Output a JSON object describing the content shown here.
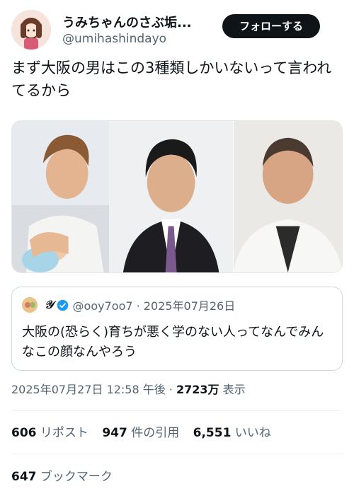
{
  "author": {
    "name": "うみちゃんのさぶ垢...",
    "handle": "@umihashindayo",
    "follow_label": "フォローする"
  },
  "tweet": {
    "text": "まず大阪の男はこの3種類しかいないって言われてるから"
  },
  "photos": [
    {
      "icon": "photo-young-man-with-baby"
    },
    {
      "icon": "photo-man-in-suit"
    },
    {
      "icon": "photo-man-in-white-jacket"
    }
  ],
  "quote": {
    "name": "𝒴",
    "handle_date": "@ooy7oo7 · 2025年07月26日",
    "text": "大阪の(恐らく)育ちが悪く学のない人ってなんでみんなこの顔なんやろう"
  },
  "meta": {
    "datetime": "2025年07月27日 12:58 午後 · ",
    "views_count": "2723万",
    "views_label": " 表示"
  },
  "stats": {
    "reposts_count": "606",
    "reposts_label": " リポスト",
    "quotes_count": "947",
    "quotes_label": " 件の引用",
    "likes_count": "6,551",
    "likes_label": " いいね"
  },
  "bookmarks": {
    "count": "647",
    "label": " ブックマーク"
  },
  "colors": {
    "text": "#0f1419",
    "secondary": "#536471",
    "border": "#cfd9de",
    "verified": "#1d9bf0"
  }
}
